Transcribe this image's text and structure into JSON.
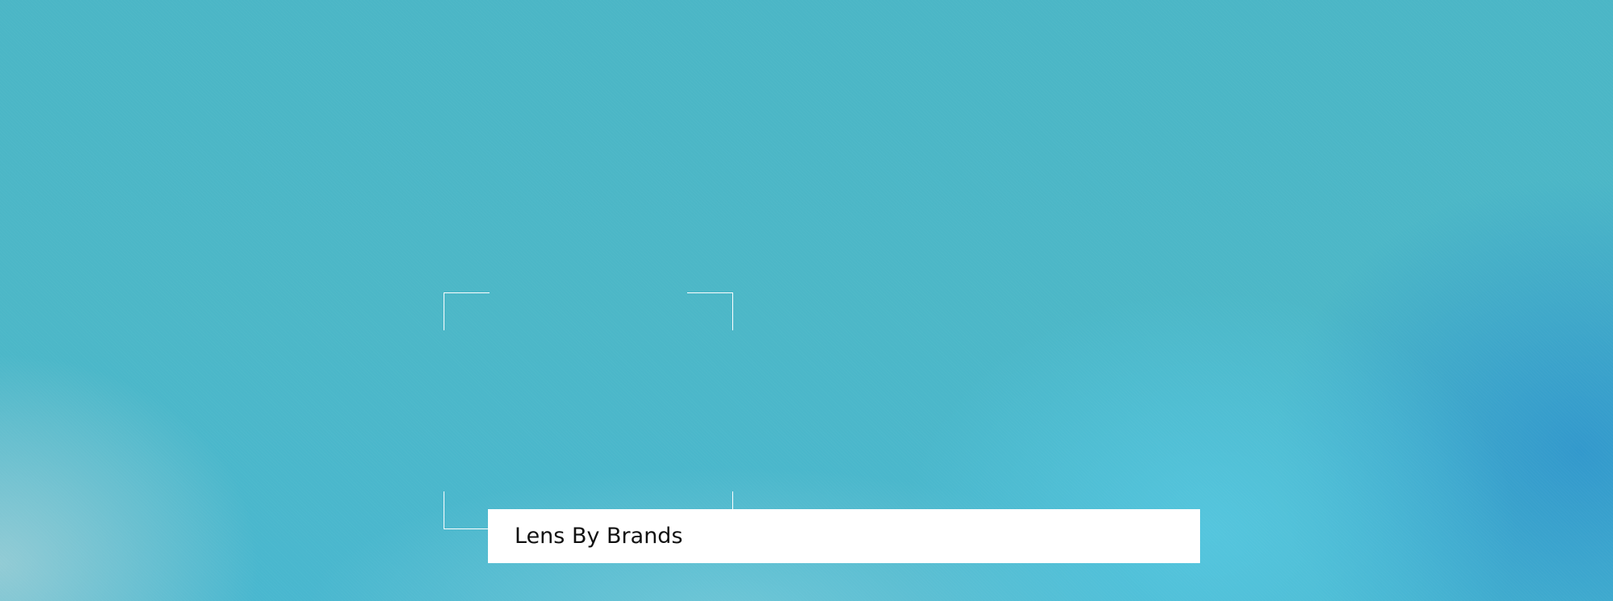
{
  "hero": {
    "title": "Lens By Brands",
    "colors": {
      "background": "#4db6c6",
      "accent_light": "#5ac8e0",
      "accent_deep": "#3aa0d0",
      "frame_lines": "#ffffff",
      "title_box": "#ffffff",
      "title_text": "#111111"
    }
  }
}
